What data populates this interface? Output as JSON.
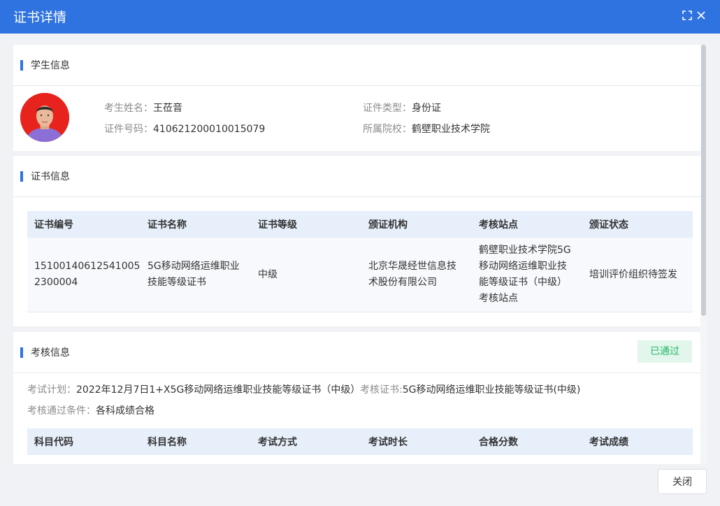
{
  "dialog": {
    "title": "证书详情",
    "close_button": "关闭"
  },
  "icons": {
    "maximize": "maximize-icon",
    "close": "close-icon"
  },
  "colors": {
    "primary": "#2f73e0",
    "success_text": "#22b866",
    "success_bg": "#e3f6ec",
    "table_header_bg": "#e6effa"
  },
  "student": {
    "section_title": "学生信息",
    "name_label": "考生姓名：",
    "name": "王莅音",
    "id_type_label": "证件类型：",
    "id_type": "身份证",
    "id_no_label": "证件号码：",
    "id_no": "410621200010015079",
    "school_label": "所属院校：",
    "school": "鹤壁职业技术学院"
  },
  "certificate": {
    "section_title": "证书信息",
    "columns": [
      "证书编号",
      "证书名称",
      "证书等级",
      "颁证机构",
      "考核站点",
      "颁证状态"
    ],
    "rows": [
      {
        "number": [
          "15100140612541005",
          "2300004"
        ],
        "name": [
          "5G移动网络运维职业",
          "技能等级证书"
        ],
        "level": "中级",
        "issuer": [
          "北京华晟经世信息技",
          "术股份有限公司"
        ],
        "site": [
          "鹤壁职业技术学院5G",
          "移动网络运维职业技",
          "能等级证书（中级）",
          "考核站点"
        ],
        "status": "培训评价组织待签发"
      }
    ]
  },
  "exam": {
    "section_title": "考核信息",
    "status_badge": "已通过",
    "plan_label": "考试计划：",
    "plan": "2022年12月7日1+X5G移动网络运维职业技能等级证书（中级）",
    "cert_label": "考核证书:",
    "cert": "5G移动网络运维职业技能等级证书(中级)",
    "pass_condition_label": "考核通过条件：",
    "pass_condition": "各科成绩合格",
    "columns": [
      "科目代码",
      "科目名称",
      "考试方式",
      "考试时长",
      "合格分数",
      "考试成绩"
    ]
  }
}
